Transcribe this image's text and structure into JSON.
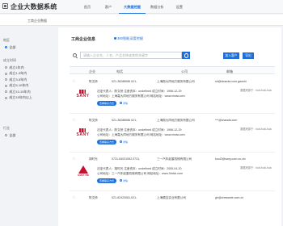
{
  "app": {
    "title": "企业大数据系统",
    "nav": [
      "首页",
      "客户",
      "大数据挖掘",
      "数据分析",
      "设置"
    ],
    "active_nav": 2
  },
  "breadcrumb": "工商企业数据",
  "filters": {
    "region": {
      "title": "地区",
      "options": [
        "全部"
      ]
    },
    "established": {
      "title": "成立时间",
      "options": [
        "成立1年内",
        "成立1-3年内",
        "成立3-5年内",
        "成立5-10年内",
        "成立10-15年内",
        "成立15年内以上"
      ]
    },
    "industry": {
      "title": "行业",
      "options": [
        "全部"
      ]
    }
  },
  "panel": {
    "title": "工商企业信息",
    "link": "360智能深度挖掘",
    "search_placeholder": "请输入企业名、人名、产品名称或其他关键字",
    "btn_add": "加入客户",
    "btn_export": "导出"
  },
  "table": {
    "headers": [
      "企业",
      "电话",
      "公司",
      "邮箱"
    ]
  },
  "companies": [
    {
      "person": "陈文桥",
      "phone": "021-38288086 021-",
      "company": "上海振大同地方服务有限公司",
      "email": "sh@shanda.com.gaoshi",
      "legal_line": "法定代表人：陈文桥  注册资本：undefined  成立时间：1998-12-29",
      "addr_line": "公司地址：上海嘉大同地方服务有限公司  网站地址：www.xinda.com",
      "logo": "SANY",
      "tag": "查看联系方式",
      "tag2": "详情",
      "hint": "数据来源于：fuck-fuck-fuck"
    },
    {
      "person": "陈文桥",
      "phone": "021-38288086 021-",
      "company": "上海振大同地方服务有限公司",
      "email": "***@shanda.com",
      "legal_line": "法定代表人：陈文桥  注册资本：undefined  成立时间：1998-12-29",
      "addr_line": "公司地址：上海嘉大同地方服务有限公司  网站地址：www.xinda.com",
      "logo": "SANY",
      "tag": "查看联系方式",
      "tag2": "详情",
      "hint": "数据来源于：fuck-fuck-fuck"
    },
    {
      "person": "胡时光",
      "phone": "0731-84031052,0731-",
      "company": "三一汽车起重机械有限公司",
      "email": "kool2@sany.com.cn,ctv",
      "legal_line": "法定代表人：胡时光  注册资本：undefined  成立时间：2005-04-20",
      "addr_line": "公司地址：三一汽车起重机械有限公司  网站地址：www.3rbick.com",
      "logo": "SANY-TRI",
      "tag": "查看联系方式",
      "tag2": "详情",
      "hint": "数据来源于：fuck-fuck-fuck"
    },
    {
      "person": "陈文桥",
      "phone": "021-62423081,021-",
      "company": "上海顺吉实业有限公司",
      "email": "gh@cheswele.com.cn",
      "legal_line": "",
      "addr_line": "",
      "logo": "",
      "tag": "",
      "tag2": "",
      "hint": ""
    }
  ]
}
